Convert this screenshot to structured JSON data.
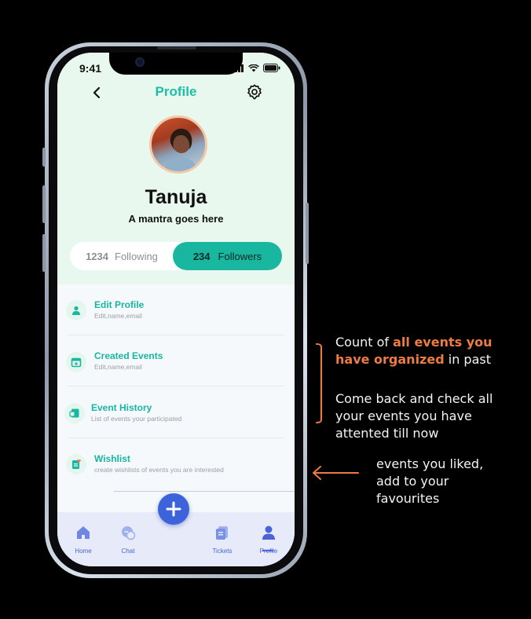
{
  "status": {
    "time": "9:41"
  },
  "header": {
    "title": "Profile"
  },
  "profile": {
    "name": "Tanuja",
    "mantra": "A mantra goes here",
    "following_count": "1234",
    "following_label": "Following",
    "followers_count": "234",
    "followers_label": "Followers"
  },
  "menu": [
    {
      "title": "Edit Profile",
      "subtitle": "Edit,name,email",
      "icon": "person-icon"
    },
    {
      "title": "Created Events",
      "subtitle": "Edit,name,email",
      "icon": "calendar-icon"
    },
    {
      "title": "Event History",
      "subtitle": "List of events your participated",
      "icon": "history-icon"
    },
    {
      "title": "Wishlist",
      "subtitle": "create wishlists of events you are interested",
      "icon": "wishlist-icon"
    }
  ],
  "nav": [
    {
      "label": "Home",
      "icon": "home-icon"
    },
    {
      "label": "Chat",
      "icon": "chat-icon"
    },
    {
      "label": "Tickets",
      "icon": "tickets-icon"
    },
    {
      "label": "Profile",
      "icon": "profile-icon",
      "active": true
    }
  ],
  "annotations": {
    "a1_pre": "Count of ",
    "a1_hl_1": "all events you",
    "a1_hl_2": "have organized",
    "a1_post": " in past",
    "a2_line1": "Come back and check all",
    "a2_line2": "your events you have",
    "a2_line3": "attented till now",
    "a3_line1": "events you liked,",
    "a3_line2": "add to your",
    "a3_line3": "favourites"
  },
  "colors": {
    "accent": "#19b6a0",
    "fab": "#3c63d9",
    "nav": "#4b63d6",
    "annotation_highlight": "#ee7b42"
  }
}
